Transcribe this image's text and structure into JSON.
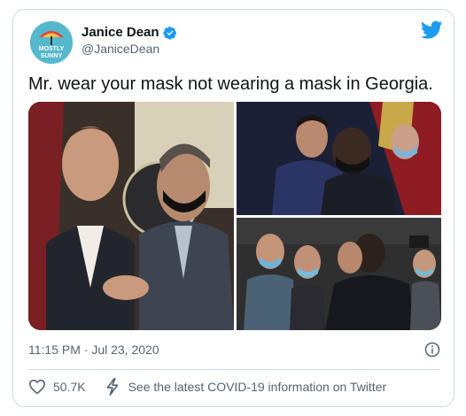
{
  "tweet": {
    "display_name": "Janice Dean",
    "handle": "@JaniceDean",
    "avatar_text": "MOSTLY SUNNY",
    "text": "Mr. wear your mask not wearing a mask in Georgia.",
    "timestamp": "11:15 PM · Jul 23, 2020",
    "like_count": "50.7K",
    "covid_link": "See the latest COVID-19 information on Twitter"
  },
  "icons": {
    "verified": "verified-badge-icon",
    "brand": "twitter-bird-icon",
    "info": "info-icon",
    "like": "heart-icon",
    "covid": "lightning-icon"
  },
  "colors": {
    "brand_blue": "#1d9bf0",
    "text_primary": "#0f1419",
    "text_secondary": "#536471",
    "border": "#cfd9de"
  }
}
